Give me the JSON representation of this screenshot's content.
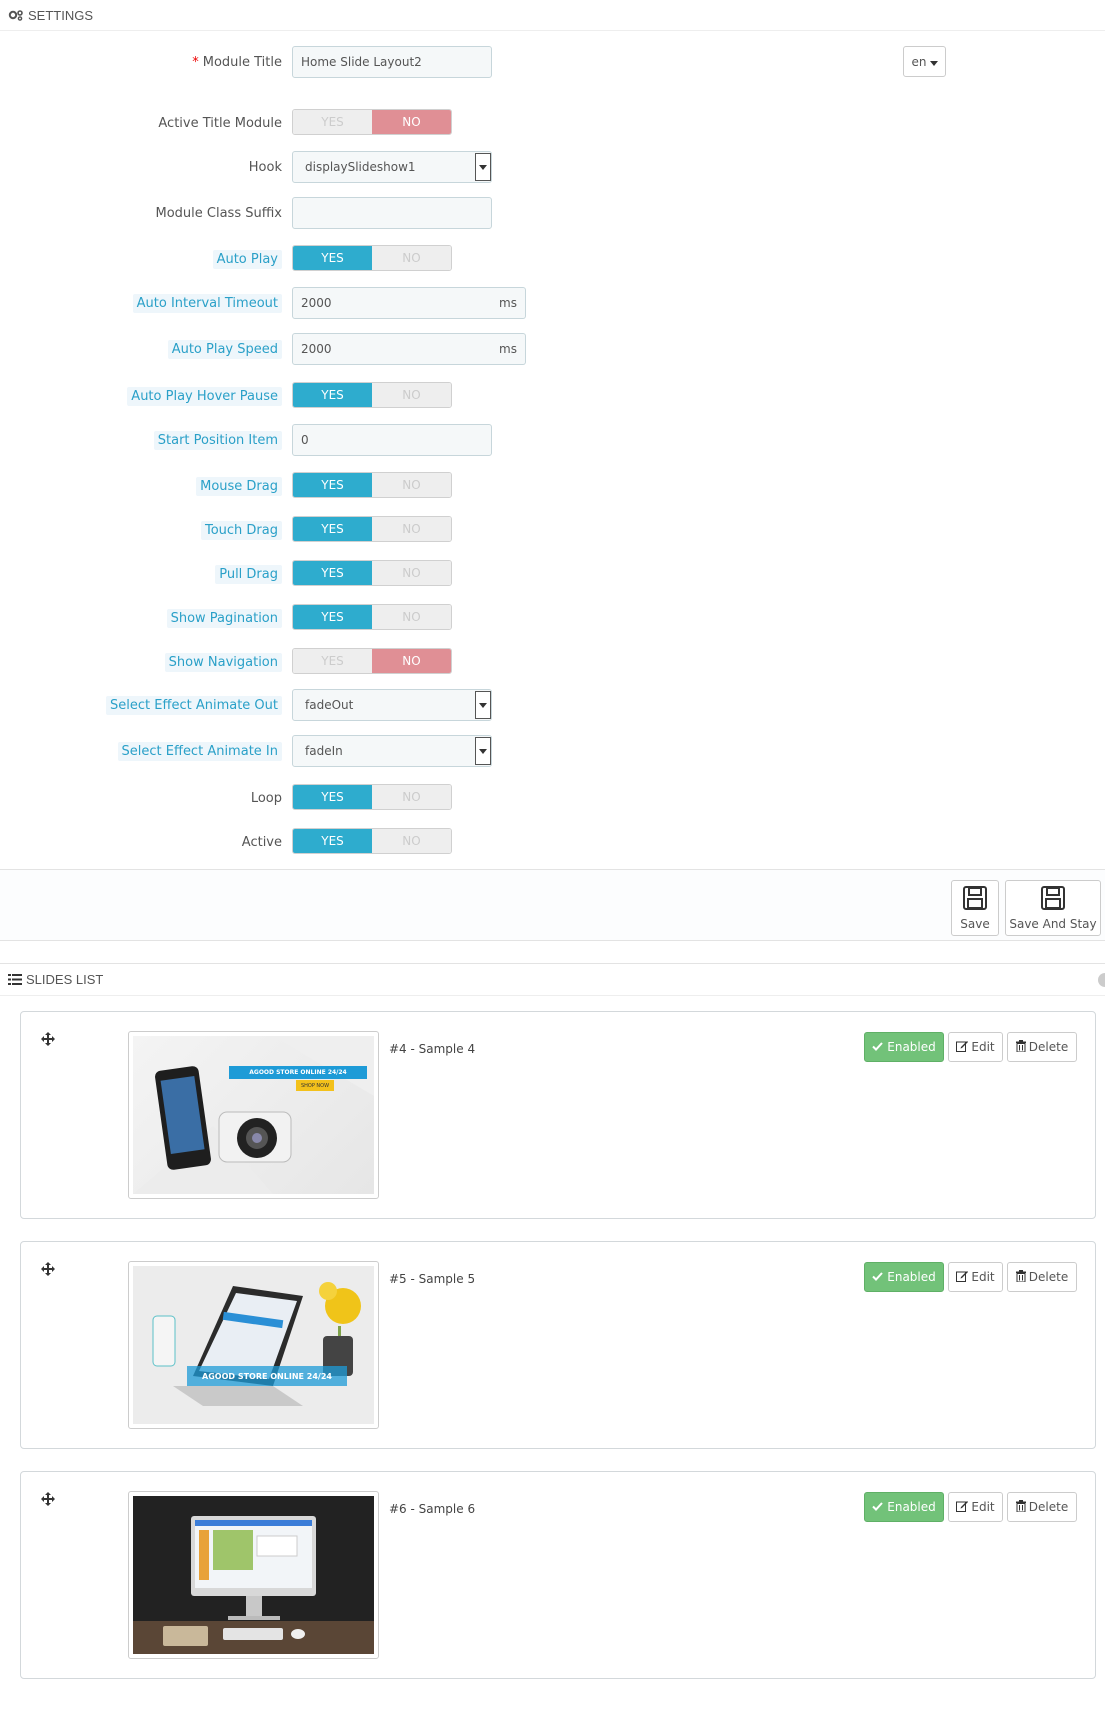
{
  "settings": {
    "heading": "SETTINGS",
    "module_title": {
      "label": "Module Title",
      "required_mark": "*",
      "value": "Home Slide Layout2"
    },
    "lang": "en",
    "active_title_module": {
      "label": "Active Title Module",
      "yes": "YES",
      "no": "NO",
      "value": "no"
    },
    "hook": {
      "label": "Hook",
      "value": "displaySlideshow1"
    },
    "module_class_suffix": {
      "label": "Module Class Suffix",
      "value": ""
    },
    "auto_play": {
      "label": "Auto Play",
      "yes": "YES",
      "no": "NO",
      "value": "yes"
    },
    "auto_interval_timeout": {
      "label": "Auto Interval Timeout",
      "value": "2000",
      "unit": "ms"
    },
    "auto_play_speed": {
      "label": "Auto Play Speed",
      "value": "2000",
      "unit": "ms"
    },
    "auto_play_hover_pause": {
      "label": "Auto Play Hover Pause",
      "yes": "YES",
      "no": "NO",
      "value": "yes"
    },
    "start_position_item": {
      "label": "Start Position Item",
      "value": "0"
    },
    "mouse_drag": {
      "label": "Mouse Drag",
      "yes": "YES",
      "no": "NO",
      "value": "yes"
    },
    "touch_drag": {
      "label": "Touch Drag",
      "yes": "YES",
      "no": "NO",
      "value": "yes"
    },
    "pull_drag": {
      "label": "Pull Drag",
      "yes": "YES",
      "no": "NO",
      "value": "yes"
    },
    "show_pagination": {
      "label": "Show Pagination",
      "yes": "YES",
      "no": "NO",
      "value": "yes"
    },
    "show_navigation": {
      "label": "Show Navigation",
      "yes": "YES",
      "no": "NO",
      "value": "no"
    },
    "effect_out": {
      "label": "Select Effect Animate Out",
      "value": "fadeOut"
    },
    "effect_in": {
      "label": "Select Effect Animate In",
      "value": "fadeIn"
    },
    "loop": {
      "label": "Loop",
      "yes": "YES",
      "no": "NO",
      "value": "yes"
    },
    "active": {
      "label": "Active",
      "yes": "YES",
      "no": "NO",
      "value": "yes"
    }
  },
  "footer": {
    "save": "Save",
    "save_and_stay": "Save And Stay"
  },
  "slides": {
    "heading": "SLIDES LIST",
    "items": [
      {
        "title": "#4 - Sample 4",
        "status": "Enabled",
        "edit": "Edit",
        "delete": "Delete",
        "banner": "AGOOD STORE ONLINE 24/24",
        "cta": "SHOP NOW"
      },
      {
        "title": "#5 - Sample 5",
        "status": "Enabled",
        "edit": "Edit",
        "delete": "Delete",
        "banner": "AGOOD STORE ONLINE 24/24"
      },
      {
        "title": "#6 - Sample 6",
        "status": "Enabled",
        "edit": "Edit",
        "delete": "Delete"
      }
    ]
  },
  "colors": {
    "toggle_on": "#2eacce",
    "toggle_no": "#e08f95",
    "enabled": "#72c279",
    "hint_text": "#2aa0c8"
  }
}
